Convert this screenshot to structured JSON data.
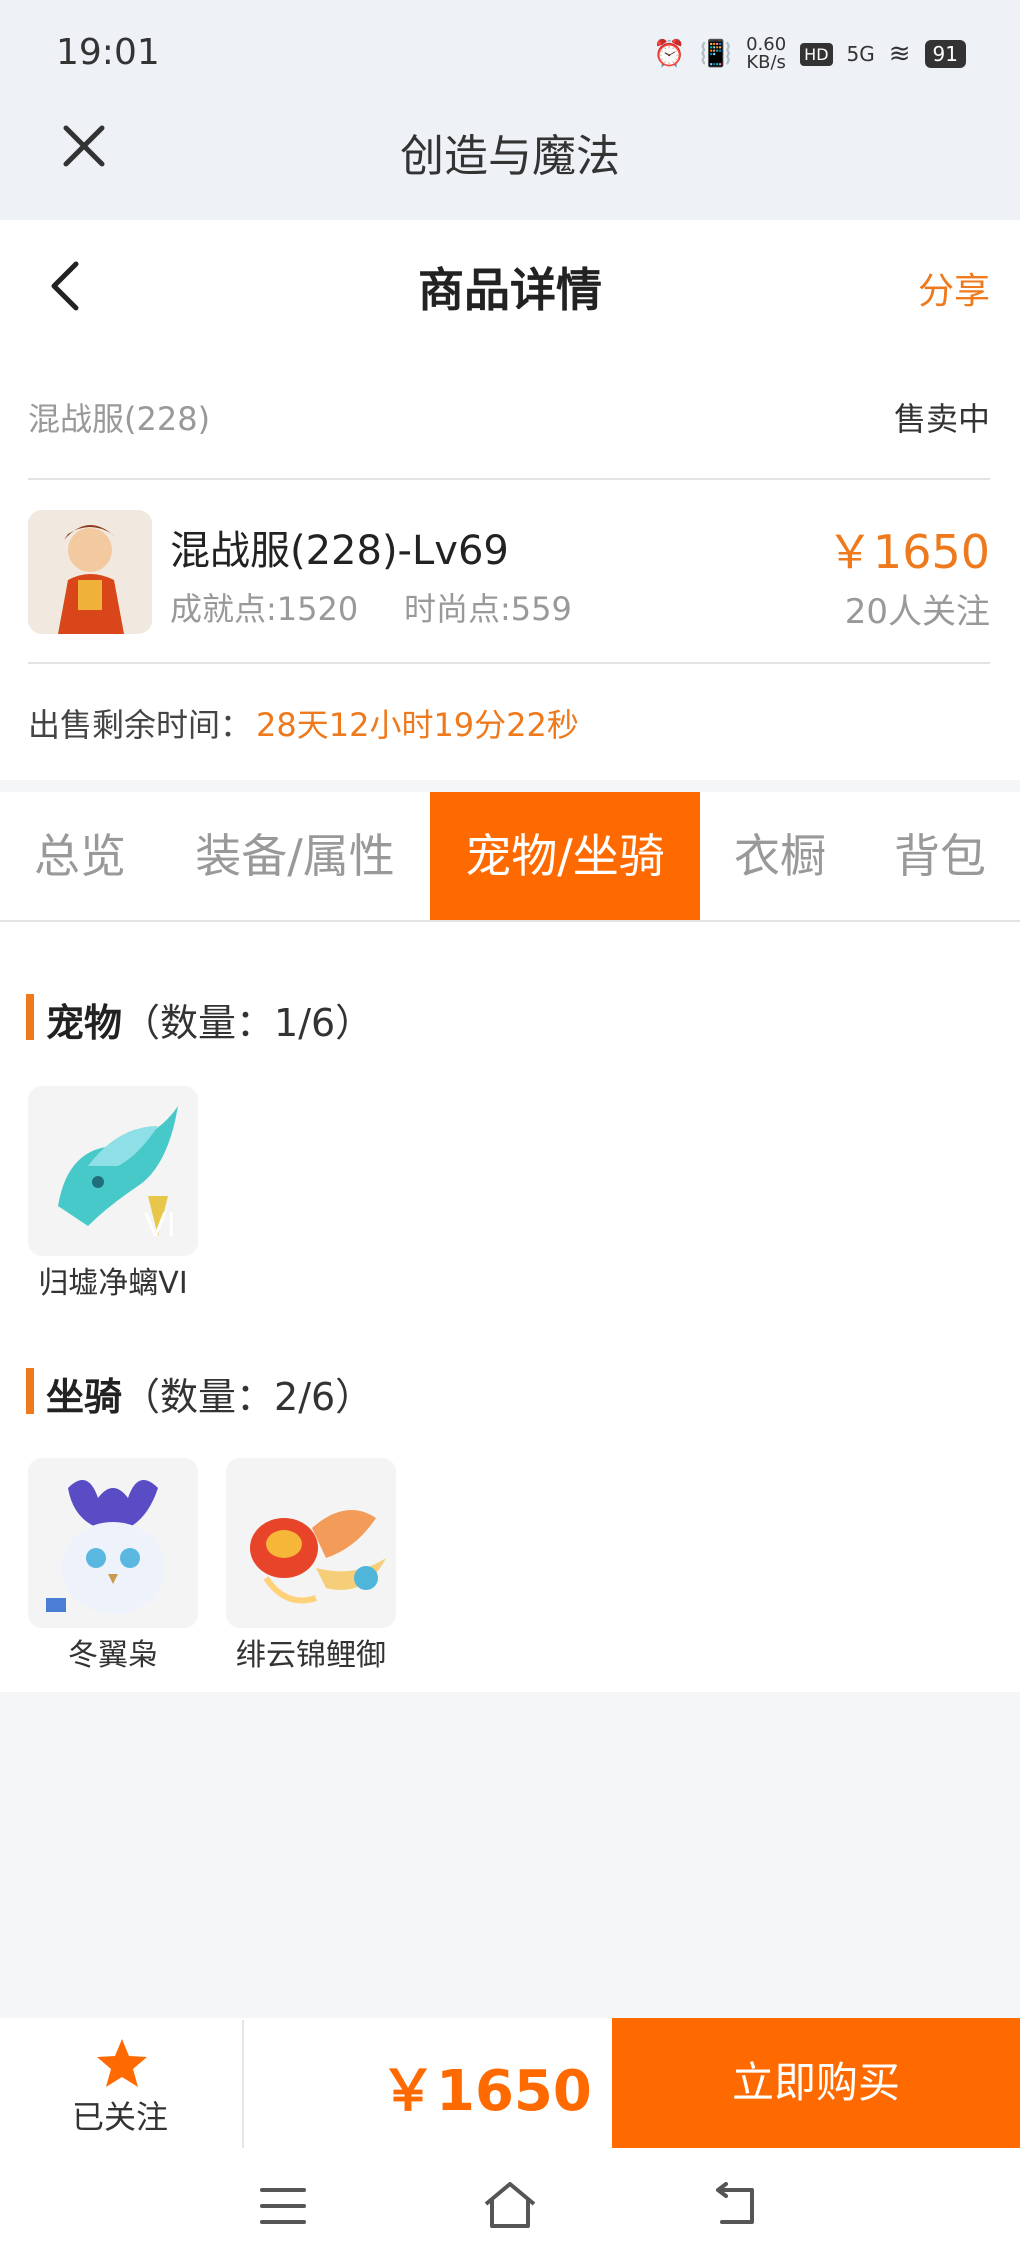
{
  "status_bar": {
    "time": "19:01",
    "net_speed": "0.60\nKB/s",
    "network": "5G",
    "hd": "HD",
    "battery": "91"
  },
  "app_bar": {
    "title": "创造与魔法"
  },
  "header": {
    "title": "商品详情",
    "share": "分享"
  },
  "listing": {
    "server": "混战服(228)",
    "status": "售卖中",
    "char_name": "混战服(228)-Lv69",
    "achievement": "成就点:1520",
    "fashion": "时尚点:559",
    "price": "￥1650",
    "followers": "20人关注",
    "remain_label": "出售剩余时间：",
    "remain_value": "28天12小时19分22秒"
  },
  "tabs": [
    {
      "label": "总览",
      "active": false
    },
    {
      "label": "装备/属性",
      "active": false
    },
    {
      "label": "宠物/坐骑",
      "active": true
    },
    {
      "label": "衣橱",
      "active": false
    },
    {
      "label": "背包",
      "active": false
    }
  ],
  "pets": {
    "title": "宠物",
    "count": "（数量：1/6）",
    "items": [
      {
        "name": "归墟净螭VI"
      }
    ]
  },
  "mounts": {
    "title": "坐骑",
    "count": "（数量：2/6）",
    "items": [
      {
        "name": "冬翼枭"
      },
      {
        "name": "绯云锦鲤御"
      }
    ]
  },
  "bottom": {
    "followed": "已关注",
    "price": "￥1650",
    "buy": "立即购买"
  },
  "colors": {
    "accent": "#ff6a00",
    "text_orange": "#ee7a1d"
  }
}
